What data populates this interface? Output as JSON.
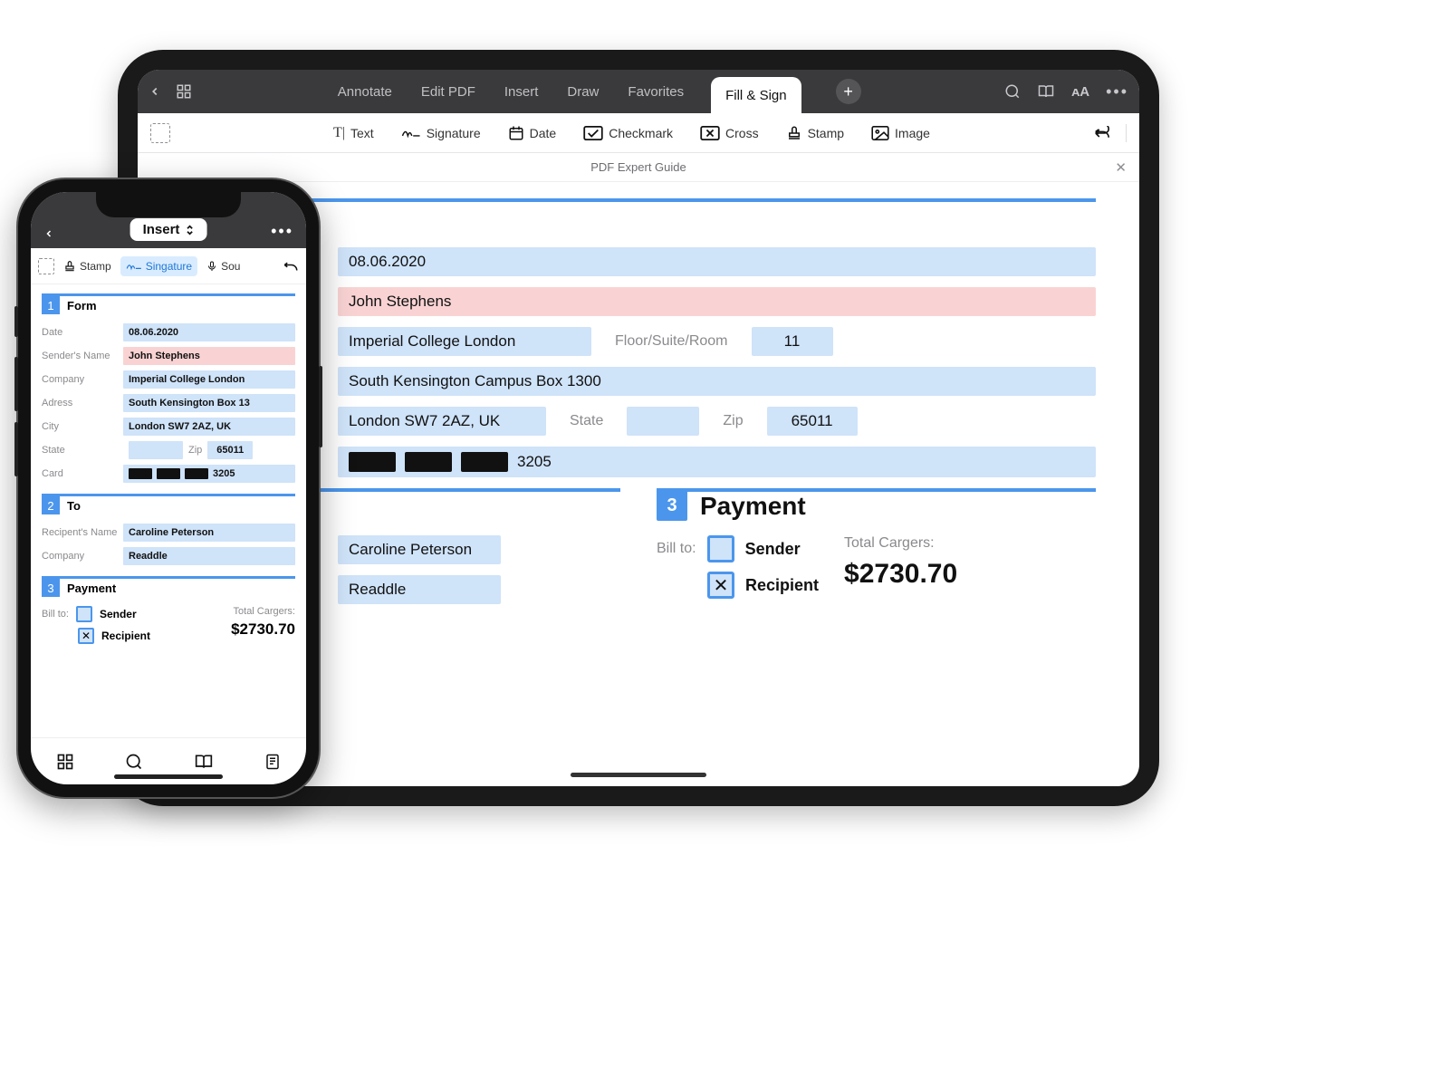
{
  "ipad": {
    "topbar": {
      "tabs": [
        "Annotate",
        "Edit PDF",
        "Insert",
        "Draw",
        "Favorites",
        "Fill & Sign"
      ],
      "active_tab": "Fill & Sign"
    },
    "toolrow": {
      "text": "Text",
      "signature": "Signature",
      "date": "Date",
      "checkmark": "Checkmark",
      "cross": "Cross",
      "stamp": "Stamp",
      "image": "Image"
    },
    "title": "PDF Expert Guide",
    "section1": {
      "num": "1",
      "title": "Form",
      "date_label": "Date",
      "date": "08.06.2020",
      "sender_label": "Sender's Name",
      "sender": "John Stephens",
      "company_label": "Company",
      "company": "Imperial College London",
      "floor_placeholder": "Floor/Suite/Room",
      "floor": "11",
      "address_label": "Adress",
      "address": "South Kensington Campus Box 1300",
      "city_label": "City",
      "city": "London SW7 2AZ, UK",
      "state_label": "State",
      "state": "",
      "zip_label": "Zip",
      "zip": "65011",
      "card_label": "Card",
      "card_last": "3205"
    },
    "section2": {
      "num": "2",
      "title": "To",
      "recipient_label": "Recipient's Name",
      "recipient": "Caroline Peterson",
      "company_label": "Company",
      "company": "Readdle"
    },
    "section3": {
      "num": "3",
      "title": "Payment",
      "billto_label": "Bill to:",
      "opt_sender": "Sender",
      "opt_recipient": "Recipient",
      "total_label": "Total Cargers:",
      "total": "$2730.70"
    }
  },
  "iphone": {
    "mode": "Insert",
    "toolrow": {
      "stamp": "Stamp",
      "signature": "Singature",
      "sound": "Sou"
    },
    "section1": {
      "num": "1",
      "title": "Form",
      "date_label": "Date",
      "date": "08.06.2020",
      "sender_label": "Sender's Name",
      "sender": "John Stephens",
      "company_label": "Company",
      "company": "Imperial College London",
      "address_label": "Adress",
      "address": "South Kensington Box 13",
      "city_label": "City",
      "city": "London SW7 2AZ, UK",
      "state_label": "State",
      "state": "",
      "zip_label": "Zip",
      "zip": "65011",
      "card_label": "Card",
      "card_last": "3205"
    },
    "section2": {
      "num": "2",
      "title": "To",
      "recipient_label": "Recipent's Name",
      "recipient": "Caroline Peterson",
      "company_label": "Company",
      "company": "Readdle"
    },
    "section3": {
      "num": "3",
      "title": "Payment",
      "billto_label": "Bill to:",
      "opt_sender": "Sender",
      "opt_recipient": "Recipient",
      "total_label": "Total Cargers:",
      "total": "$2730.70"
    }
  }
}
